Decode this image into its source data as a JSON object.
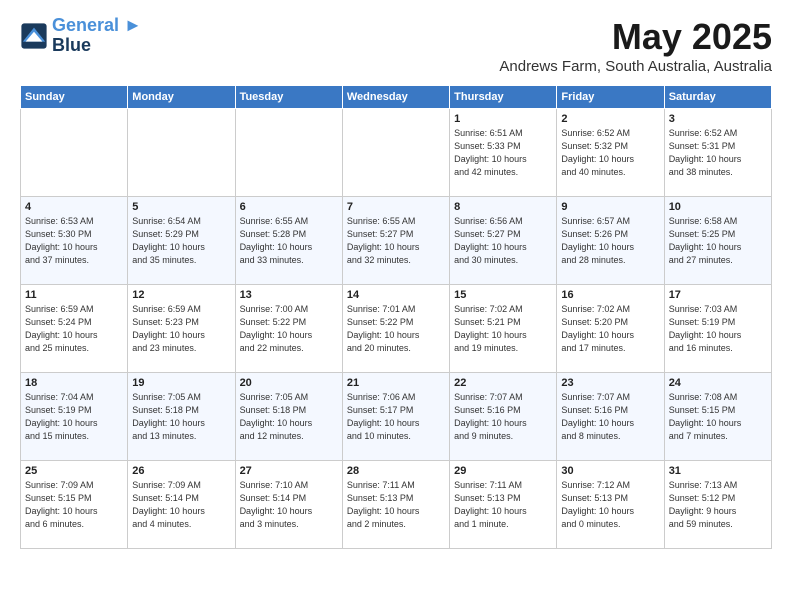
{
  "logo": {
    "line1": "General",
    "line2": "Blue"
  },
  "title": "May 2025",
  "location": "Andrews Farm, South Australia, Australia",
  "days_of_week": [
    "Sunday",
    "Monday",
    "Tuesday",
    "Wednesday",
    "Thursday",
    "Friday",
    "Saturday"
  ],
  "weeks": [
    [
      {
        "day": "",
        "content": ""
      },
      {
        "day": "",
        "content": ""
      },
      {
        "day": "",
        "content": ""
      },
      {
        "day": "",
        "content": ""
      },
      {
        "day": "1",
        "content": "Sunrise: 6:51 AM\nSunset: 5:33 PM\nDaylight: 10 hours\nand 42 minutes."
      },
      {
        "day": "2",
        "content": "Sunrise: 6:52 AM\nSunset: 5:32 PM\nDaylight: 10 hours\nand 40 minutes."
      },
      {
        "day": "3",
        "content": "Sunrise: 6:52 AM\nSunset: 5:31 PM\nDaylight: 10 hours\nand 38 minutes."
      }
    ],
    [
      {
        "day": "4",
        "content": "Sunrise: 6:53 AM\nSunset: 5:30 PM\nDaylight: 10 hours\nand 37 minutes."
      },
      {
        "day": "5",
        "content": "Sunrise: 6:54 AM\nSunset: 5:29 PM\nDaylight: 10 hours\nand 35 minutes."
      },
      {
        "day": "6",
        "content": "Sunrise: 6:55 AM\nSunset: 5:28 PM\nDaylight: 10 hours\nand 33 minutes."
      },
      {
        "day": "7",
        "content": "Sunrise: 6:55 AM\nSunset: 5:27 PM\nDaylight: 10 hours\nand 32 minutes."
      },
      {
        "day": "8",
        "content": "Sunrise: 6:56 AM\nSunset: 5:27 PM\nDaylight: 10 hours\nand 30 minutes."
      },
      {
        "day": "9",
        "content": "Sunrise: 6:57 AM\nSunset: 5:26 PM\nDaylight: 10 hours\nand 28 minutes."
      },
      {
        "day": "10",
        "content": "Sunrise: 6:58 AM\nSunset: 5:25 PM\nDaylight: 10 hours\nand 27 minutes."
      }
    ],
    [
      {
        "day": "11",
        "content": "Sunrise: 6:59 AM\nSunset: 5:24 PM\nDaylight: 10 hours\nand 25 minutes."
      },
      {
        "day": "12",
        "content": "Sunrise: 6:59 AM\nSunset: 5:23 PM\nDaylight: 10 hours\nand 23 minutes."
      },
      {
        "day": "13",
        "content": "Sunrise: 7:00 AM\nSunset: 5:22 PM\nDaylight: 10 hours\nand 22 minutes."
      },
      {
        "day": "14",
        "content": "Sunrise: 7:01 AM\nSunset: 5:22 PM\nDaylight: 10 hours\nand 20 minutes."
      },
      {
        "day": "15",
        "content": "Sunrise: 7:02 AM\nSunset: 5:21 PM\nDaylight: 10 hours\nand 19 minutes."
      },
      {
        "day": "16",
        "content": "Sunrise: 7:02 AM\nSunset: 5:20 PM\nDaylight: 10 hours\nand 17 minutes."
      },
      {
        "day": "17",
        "content": "Sunrise: 7:03 AM\nSunset: 5:19 PM\nDaylight: 10 hours\nand 16 minutes."
      }
    ],
    [
      {
        "day": "18",
        "content": "Sunrise: 7:04 AM\nSunset: 5:19 PM\nDaylight: 10 hours\nand 15 minutes."
      },
      {
        "day": "19",
        "content": "Sunrise: 7:05 AM\nSunset: 5:18 PM\nDaylight: 10 hours\nand 13 minutes."
      },
      {
        "day": "20",
        "content": "Sunrise: 7:05 AM\nSunset: 5:18 PM\nDaylight: 10 hours\nand 12 minutes."
      },
      {
        "day": "21",
        "content": "Sunrise: 7:06 AM\nSunset: 5:17 PM\nDaylight: 10 hours\nand 10 minutes."
      },
      {
        "day": "22",
        "content": "Sunrise: 7:07 AM\nSunset: 5:16 PM\nDaylight: 10 hours\nand 9 minutes."
      },
      {
        "day": "23",
        "content": "Sunrise: 7:07 AM\nSunset: 5:16 PM\nDaylight: 10 hours\nand 8 minutes."
      },
      {
        "day": "24",
        "content": "Sunrise: 7:08 AM\nSunset: 5:15 PM\nDaylight: 10 hours\nand 7 minutes."
      }
    ],
    [
      {
        "day": "25",
        "content": "Sunrise: 7:09 AM\nSunset: 5:15 PM\nDaylight: 10 hours\nand 6 minutes."
      },
      {
        "day": "26",
        "content": "Sunrise: 7:09 AM\nSunset: 5:14 PM\nDaylight: 10 hours\nand 4 minutes."
      },
      {
        "day": "27",
        "content": "Sunrise: 7:10 AM\nSunset: 5:14 PM\nDaylight: 10 hours\nand 3 minutes."
      },
      {
        "day": "28",
        "content": "Sunrise: 7:11 AM\nSunset: 5:13 PM\nDaylight: 10 hours\nand 2 minutes."
      },
      {
        "day": "29",
        "content": "Sunrise: 7:11 AM\nSunset: 5:13 PM\nDaylight: 10 hours\nand 1 minute."
      },
      {
        "day": "30",
        "content": "Sunrise: 7:12 AM\nSunset: 5:13 PM\nDaylight: 10 hours\nand 0 minutes."
      },
      {
        "day": "31",
        "content": "Sunrise: 7:13 AM\nSunset: 5:12 PM\nDaylight: 9 hours\nand 59 minutes."
      }
    ]
  ]
}
